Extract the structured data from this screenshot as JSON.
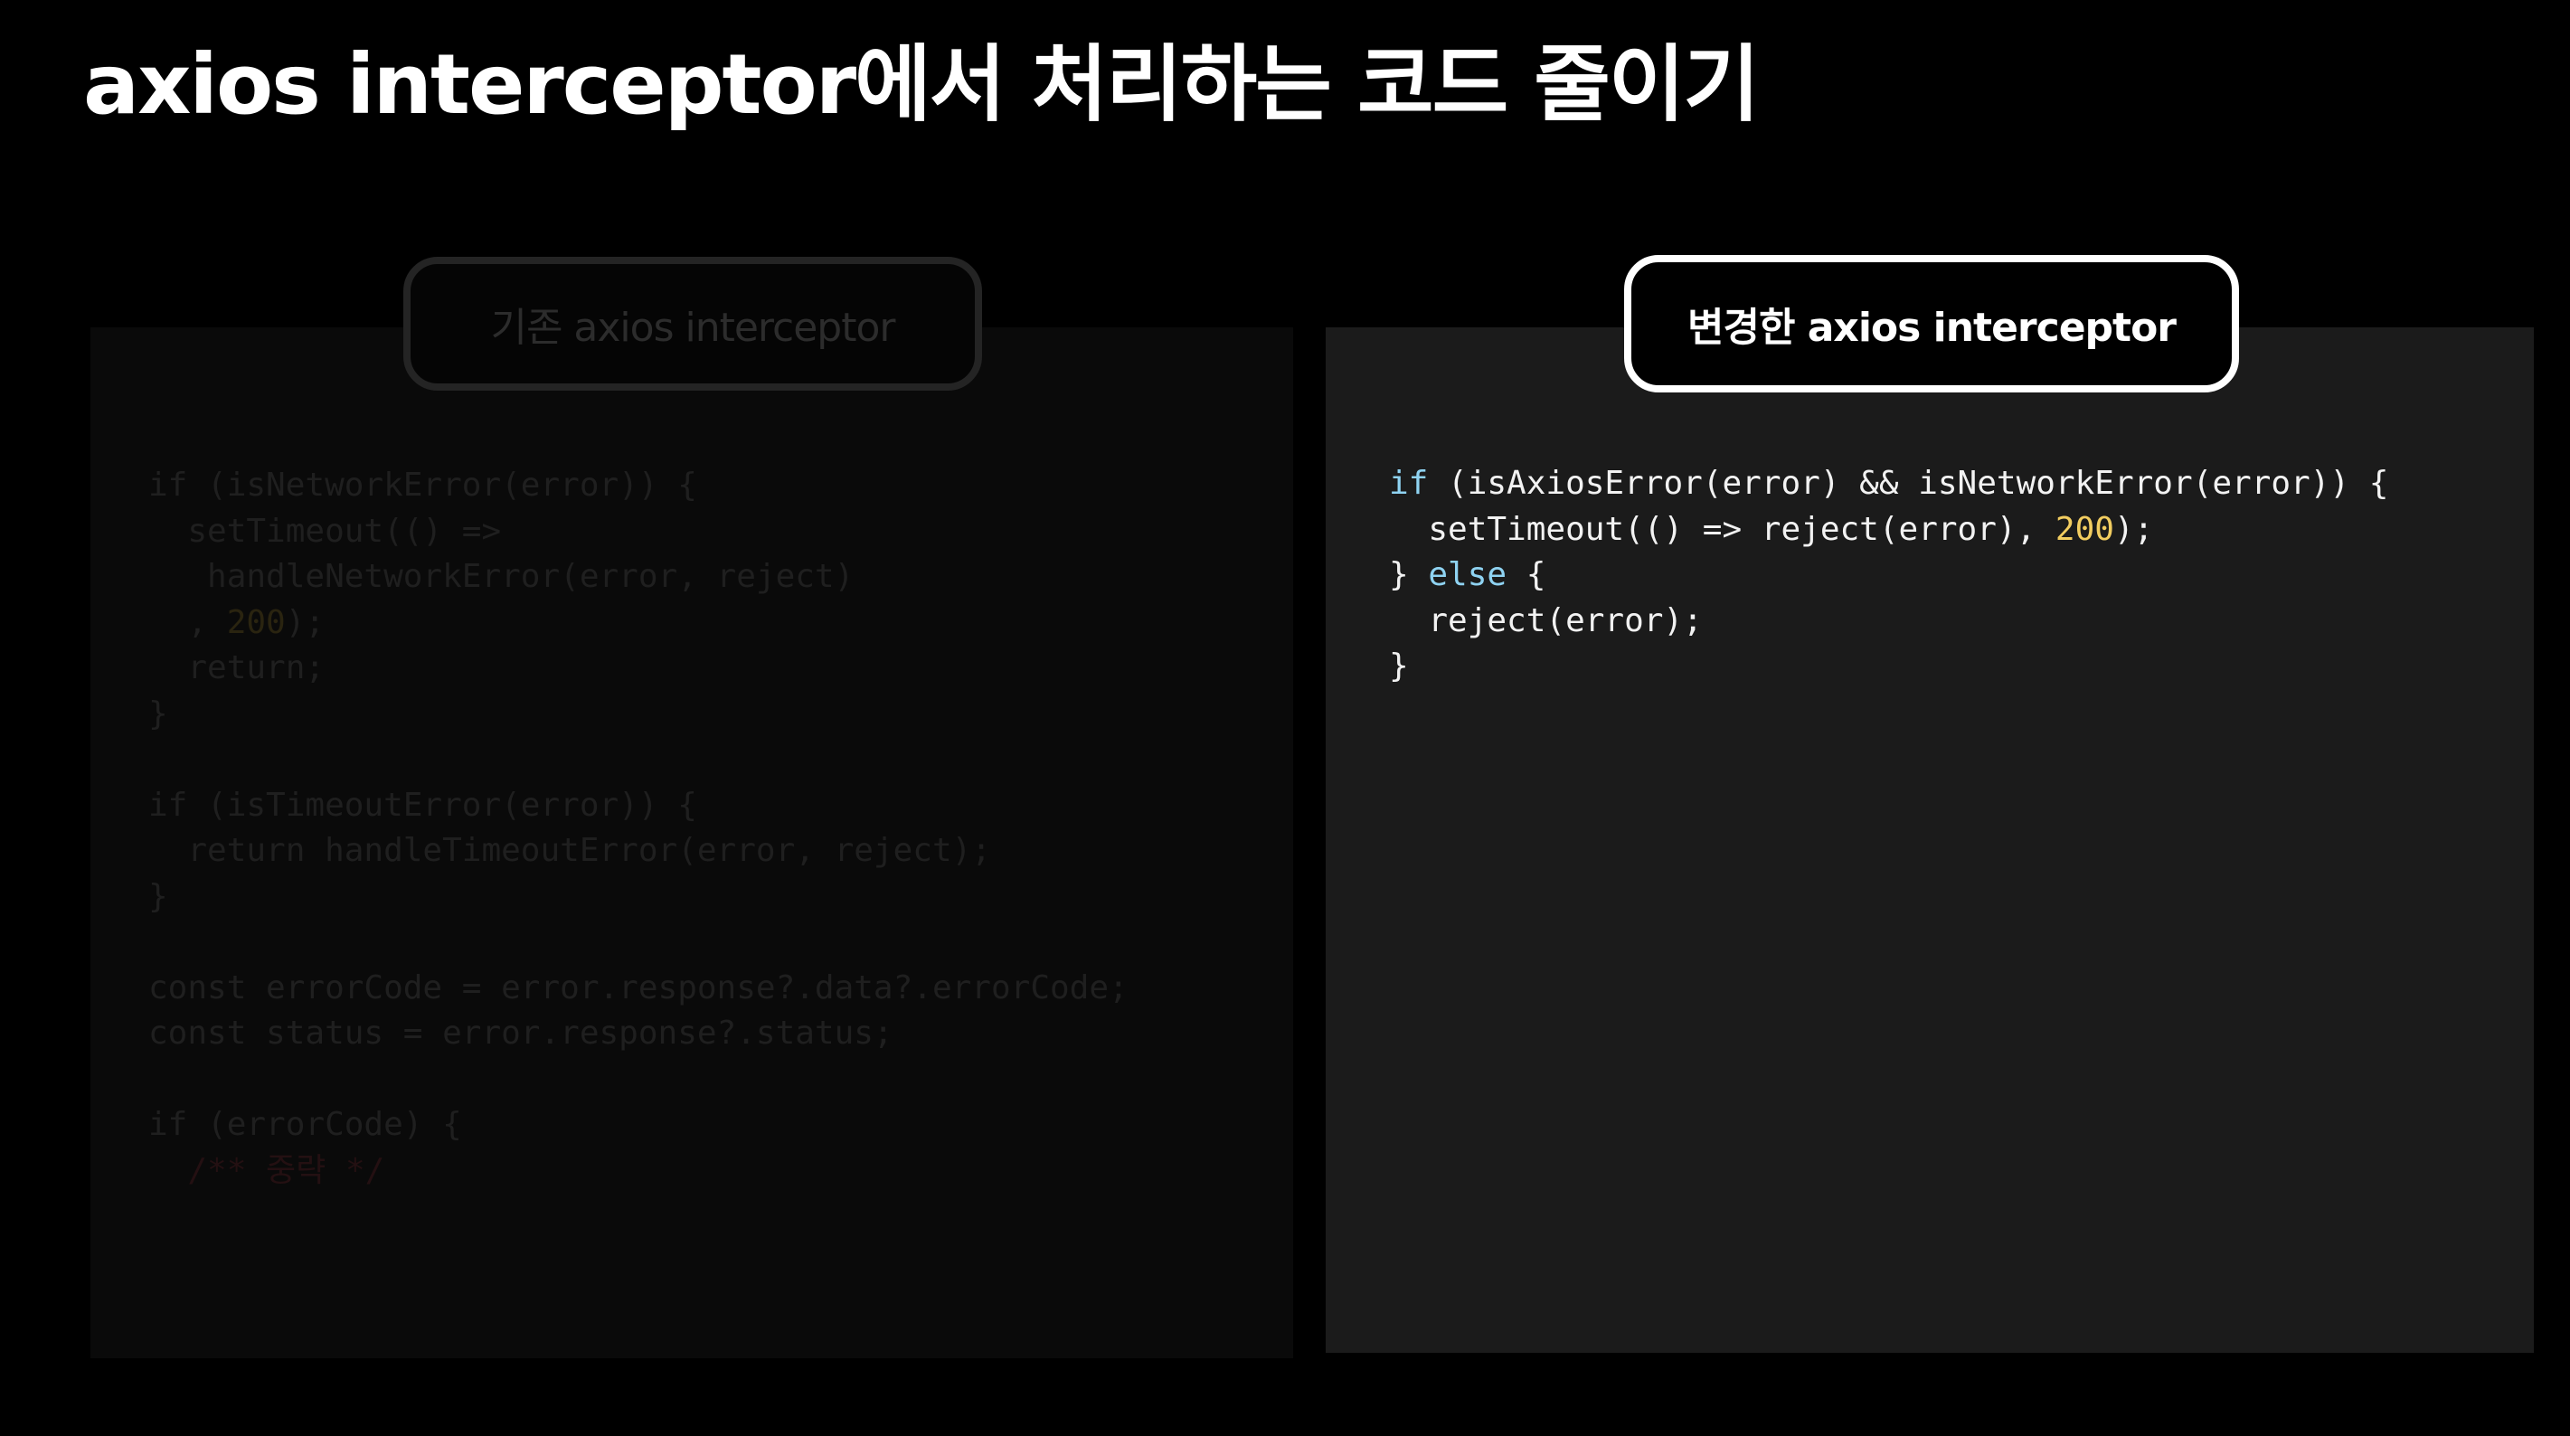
{
  "slide": {
    "title": "axios interceptor에서 처리하는 코드 줄이기"
  },
  "left_panel": {
    "label": "기존 axios interceptor",
    "code": [
      [
        {
          "t": "if (isNetworkError(error)) {"
        }
      ],
      [
        {
          "t": "  setTimeout(() =>"
        }
      ],
      [
        {
          "t": "   handleNetworkError(error, reject)"
        }
      ],
      [
        {
          "t": "  , "
        },
        {
          "t": "200",
          "c": "num"
        },
        {
          "t": ");"
        }
      ],
      [
        {
          "t": "  return;"
        }
      ],
      [
        {
          "t": "}"
        }
      ],
      [
        {
          "t": ""
        }
      ],
      [
        {
          "t": "if (isTimeoutError(error)) {"
        }
      ],
      [
        {
          "t": "  return handleTimeoutError(error, reject);"
        }
      ],
      [
        {
          "t": "}"
        }
      ],
      [
        {
          "t": ""
        }
      ],
      [
        {
          "t": "const errorCode = error.response?.data?.errorCode;"
        }
      ],
      [
        {
          "t": "const status = error.response?.status;"
        }
      ],
      [
        {
          "t": ""
        }
      ],
      [
        {
          "t": "if (errorCode) {"
        }
      ],
      [
        {
          "t": "  /** 중략 */",
          "c": "cmt"
        }
      ]
    ]
  },
  "right_panel": {
    "label": "변경한 axios interceptor",
    "code": [
      [
        {
          "t": "if",
          "c": "kw"
        },
        {
          "t": " (isAxiosError(error) && isNetworkError(error)) {"
        }
      ],
      [
        {
          "t": "  setTimeout(() => reject(error), "
        },
        {
          "t": "200",
          "c": "num"
        },
        {
          "t": ");"
        }
      ],
      [
        {
          "t": "} "
        },
        {
          "t": "else",
          "c": "kw"
        },
        {
          "t": " {"
        }
      ],
      [
        {
          "t": "  reject(error);"
        }
      ],
      [
        {
          "t": "}"
        }
      ]
    ]
  },
  "colors": {
    "background": "#000000",
    "active_panel": "#1b1b1b",
    "keyword": "#8fd3f2",
    "number": "#f2cd60"
  }
}
